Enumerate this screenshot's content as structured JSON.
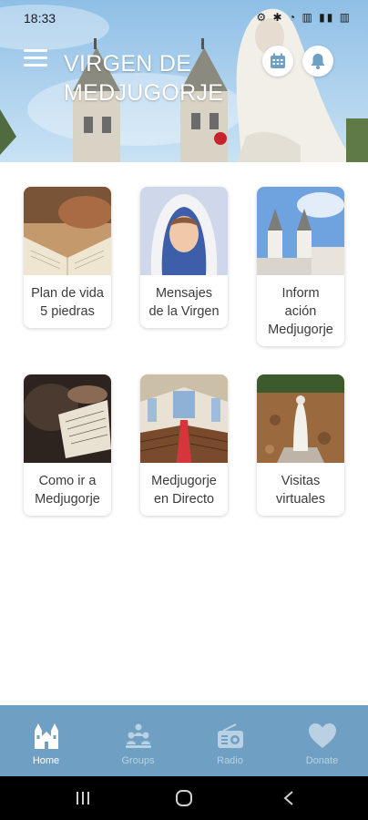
{
  "status_bar": {
    "time": "18:33"
  },
  "header": {
    "title_line1": "VIRGEN DE",
    "title_line2": "MEDJUGORJE"
  },
  "tiles": [
    {
      "label_line1": "Plan de vida",
      "label_line2": "5 piedras",
      "label_line3": ""
    },
    {
      "label_line1": "Mensajes",
      "label_line2": "de la Virgen",
      "label_line3": ""
    },
    {
      "label_line1": "Inform",
      "label_line2": "ación",
      "label_line3": "Medjugorje"
    },
    {
      "label_line1": "Como ir a",
      "label_line2": "Medjugorje",
      "label_line3": ""
    },
    {
      "label_line1": "Medjugorje",
      "label_line2": "en Directo",
      "label_line3": ""
    },
    {
      "label_line1": "Visitas",
      "label_line2": "virtuales",
      "label_line3": ""
    }
  ],
  "bottom_nav": [
    {
      "label": "Home",
      "icon": "church-icon",
      "active": true
    },
    {
      "label": "Groups",
      "icon": "groups-icon",
      "active": false
    },
    {
      "label": "Radio",
      "icon": "radio-icon",
      "active": false
    },
    {
      "label": "Donate",
      "icon": "heart-icon",
      "active": false
    }
  ],
  "colors": {
    "nav_background": "#6fa0c3",
    "nav_active": "#ffffff",
    "nav_inactive": "#b9d1e2",
    "header_button": "#6fa0c3"
  }
}
